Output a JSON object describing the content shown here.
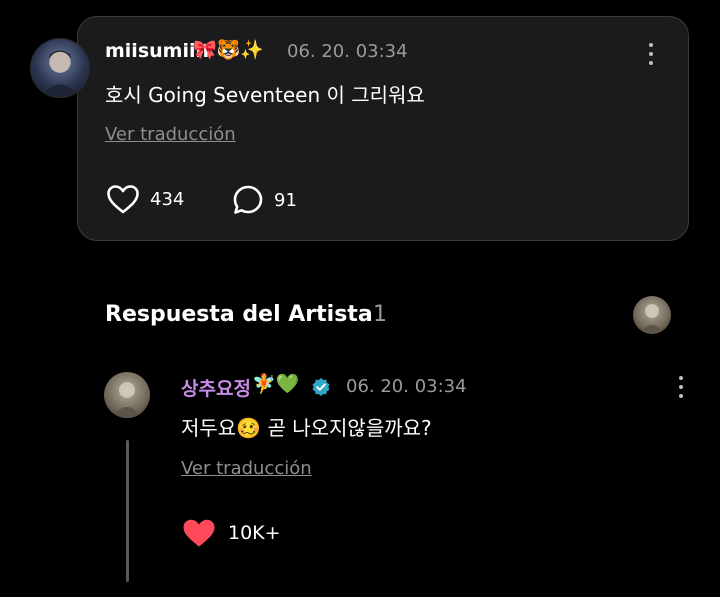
{
  "post": {
    "username": "miisumiin",
    "username_emojis": "🎀🐯✨",
    "timestamp": "06. 20. 03:34",
    "text": "호시 Going Seventeen 이 그리워요",
    "translate_label": "Ver traducción",
    "likes": "434",
    "comments": "91"
  },
  "artist_section": {
    "title": "Respuesta del Artista",
    "count": "1"
  },
  "reply": {
    "name": "상추요정",
    "name_emojis": "🧚💚",
    "timestamp": "06. 20. 03:34",
    "text": "저두요🥴 곧 나오지않을까요?",
    "translate_label": "Ver traducción",
    "likes": "10K+"
  },
  "colors": {
    "background": "#000000",
    "card": "#1b1b1d",
    "artist_name": "#c98be8",
    "heart": "#ff4a5c",
    "verified": "#2ea7c9"
  },
  "icons": [
    "heart-outline-icon",
    "comment-bubble-icon",
    "more-vertical-icon",
    "verified-badge-icon",
    "heart-filled-icon"
  ]
}
